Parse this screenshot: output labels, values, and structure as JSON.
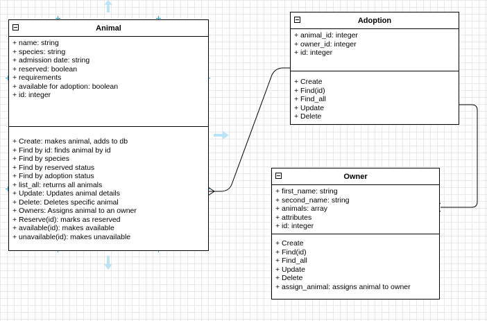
{
  "classes": {
    "animal": {
      "title": "Animal",
      "attributes": [
        "+ name: string",
        "+ species: string",
        "+ admission date: string",
        "+ reserved: boolean",
        "+ requirements",
        "+ available for adoption: boolean",
        "+ id: integer"
      ],
      "methods": [
        "+ Create: makes animal, adds to db",
        "+ Find by id:  finds animal by id",
        "+ Find by species",
        "+ Find by reserved status",
        "+ Find by adoption status",
        "+ list_all: returns all animals",
        "+ Update: Updates animal details",
        "+ Delete: Deletes specific animal",
        "+ Owners: Assigns animal to an owner",
        "+ Reserve(id): marks as reserved",
        "+ available(id): makes available",
        "+ unavailable(id): makes unavailable"
      ]
    },
    "adoption": {
      "title": "Adoption",
      "attributes": [
        "+ animal_id: integer",
        "+ owner_id: integer",
        "+ id: integer"
      ],
      "methods": [
        "+ Create",
        "+ Find(id)",
        "+ Find_all",
        "+ Update",
        "+ Delete"
      ]
    },
    "owner": {
      "title": "Owner",
      "attributes": [
        "+ first_name: string",
        "+ second_name: string",
        "+ animals: array",
        "+ attributes",
        "+ id: integer"
      ],
      "methods": [
        "+ Create",
        "+ Find(id)",
        "+ Find_all",
        "+ Update",
        "+ Delete",
        "+ assign_animal: assigns animal to owner"
      ]
    }
  },
  "colors": {
    "line": "#000000",
    "selection": "#29a8e0",
    "selection_light": "#b9e4f7",
    "grid": "#e9e9e9"
  }
}
